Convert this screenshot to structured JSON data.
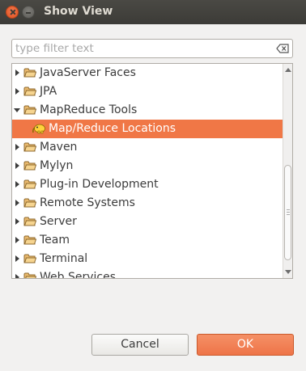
{
  "window": {
    "title": "Show View"
  },
  "filter": {
    "placeholder": "type filter text",
    "value": ""
  },
  "tree": {
    "items": [
      {
        "label": "JavaServer Faces",
        "expanded": false,
        "selected": false,
        "type": "folder"
      },
      {
        "label": "JPA",
        "expanded": false,
        "selected": false,
        "type": "folder"
      },
      {
        "label": "MapReduce Tools",
        "expanded": true,
        "selected": false,
        "type": "folder"
      },
      {
        "label": "Map/Reduce Locations",
        "expanded": false,
        "selected": true,
        "type": "elephant-icon"
      },
      {
        "label": "Maven",
        "expanded": false,
        "selected": false,
        "type": "folder"
      },
      {
        "label": "Mylyn",
        "expanded": false,
        "selected": false,
        "type": "folder"
      },
      {
        "label": "Plug-in Development",
        "expanded": false,
        "selected": false,
        "type": "folder"
      },
      {
        "label": "Remote Systems",
        "expanded": false,
        "selected": false,
        "type": "folder"
      },
      {
        "label": "Server",
        "expanded": false,
        "selected": false,
        "type": "folder"
      },
      {
        "label": "Team",
        "expanded": false,
        "selected": false,
        "type": "folder"
      },
      {
        "label": "Terminal",
        "expanded": false,
        "selected": false,
        "type": "folder"
      },
      {
        "label": "Web Services",
        "expanded": false,
        "selected": false,
        "type": "folder"
      }
    ]
  },
  "buttons": {
    "cancel": "Cancel",
    "ok": "OK"
  },
  "colors": {
    "accent": "#f07746",
    "titlebar": "#3c3b37",
    "dialog_bg": "#f2f1f0"
  }
}
